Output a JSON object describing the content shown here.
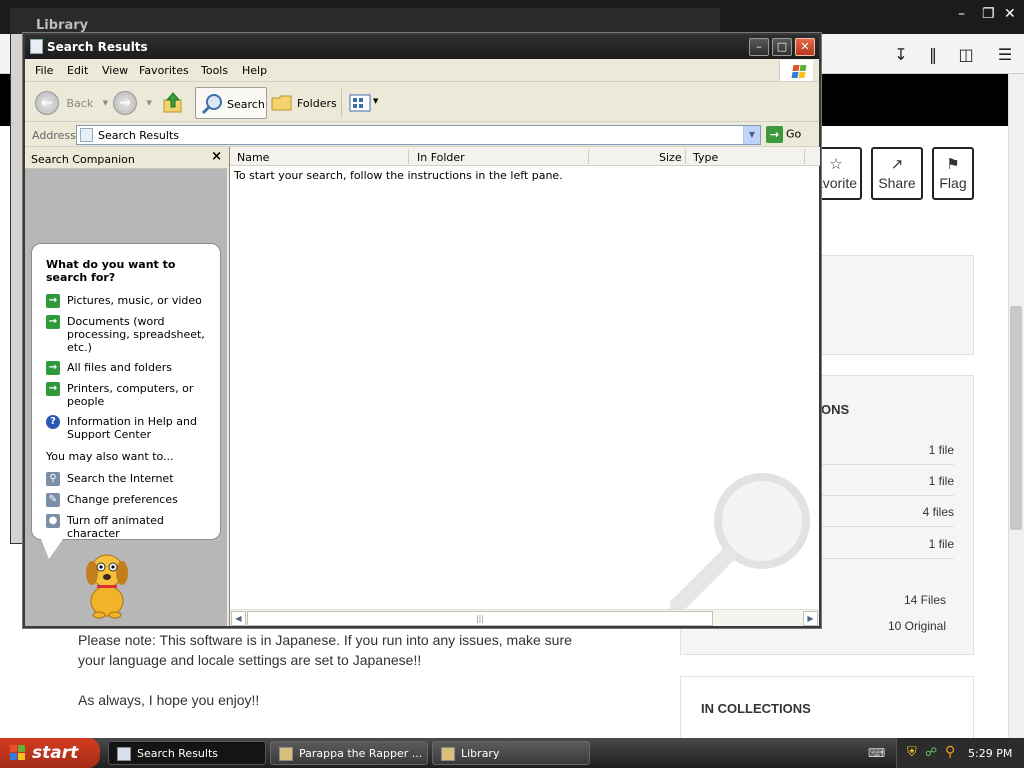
{
  "background": {
    "library_title": "Library",
    "buttons": [
      {
        "label": "avorite",
        "icon": "star-icon"
      },
      {
        "label": "Share",
        "icon": "share-icon"
      },
      {
        "label": "Flag",
        "icon": "flag-icon"
      }
    ],
    "file_section_title": "ONS",
    "file_rows": [
      "1 file",
      "1 file",
      "4 files",
      "1 file"
    ],
    "summary": [
      "14 Files",
      "10 Original"
    ],
    "note_lines": [
      "Please note: This software is in Japanese. If you run into any issues, make sure",
      "your language and locale settings are set to Japanese!!",
      "As always, I hope you enjoy!!"
    ],
    "collections_title": "IN COLLECTIONS"
  },
  "window": {
    "title": "Search Results",
    "menu": [
      "File",
      "Edit",
      "View",
      "Favorites",
      "Tools",
      "Help"
    ],
    "toolbar": {
      "back_label": "Back",
      "search_label": "Search",
      "folders_label": "Folders"
    },
    "address": {
      "label": "Address",
      "value": "Search Results",
      "go_label": "Go"
    },
    "companion": {
      "header": "Search Companion",
      "question": "What do you want to search for?",
      "options": [
        "Pictures, music, or video",
        "Documents (word processing, spreadsheet, etc.)",
        "All files and folders",
        "Printers, computers, or people",
        "Information in Help and Support Center"
      ],
      "also_label": "You may also want to...",
      "also_options": [
        "Search the Internet",
        "Change preferences",
        "Turn off animated character"
      ]
    },
    "list": {
      "columns": [
        "Name",
        "In Folder",
        "Size",
        "Type"
      ],
      "empty_message": "To start your search, follow the instructions in the left pane."
    }
  },
  "taskbar": {
    "start_label": "start",
    "tasks": [
      "Search Results",
      "Parappa the Rapper ...",
      "Library"
    ],
    "clock": "5:29 PM"
  },
  "colors": {
    "xp_green": "#2f9a3a",
    "close_red": "#d24a2a",
    "taskbar": "#2a2a2a"
  }
}
